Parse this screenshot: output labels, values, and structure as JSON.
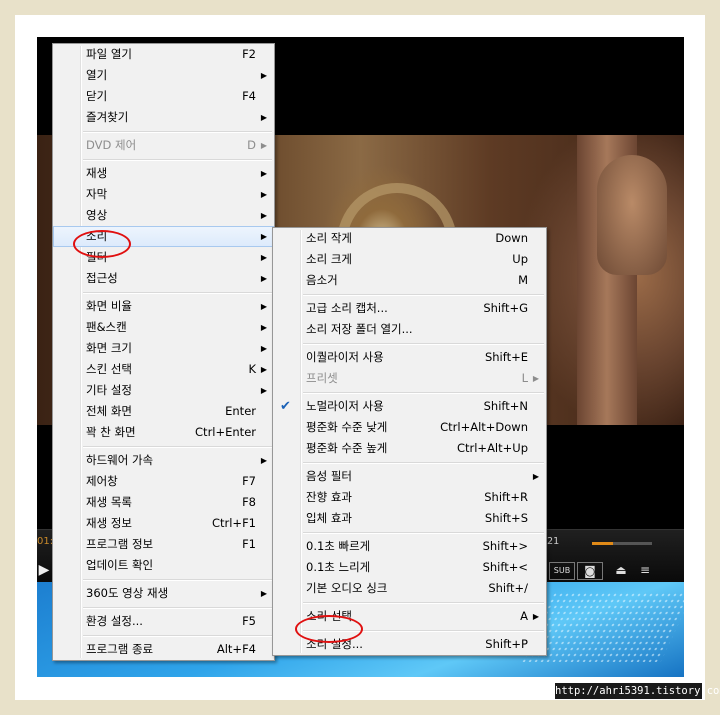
{
  "video": {
    "time_left": "01:",
    "time_right": "21",
    "seek_progress": 0.35,
    "sub_label": "SUB"
  },
  "watermark": "http://ahri5391.tistory.com",
  "main_menu": [
    {
      "label": "파일 열기",
      "shortcut": "F2"
    },
    {
      "label": "열기",
      "arrow": true
    },
    {
      "label": "닫기",
      "shortcut": "F4"
    },
    {
      "label": "즐겨찾기",
      "arrow": true
    },
    {
      "sep": true
    },
    {
      "label": "DVD 제어",
      "shortcut": "D",
      "arrow": true,
      "disabled": true
    },
    {
      "sep": true
    },
    {
      "label": "재생",
      "arrow": true
    },
    {
      "label": "자막",
      "arrow": true
    },
    {
      "label": "영상",
      "arrow": true
    },
    {
      "label": "소리",
      "arrow": true,
      "highlight": true
    },
    {
      "label": "필터",
      "arrow": true
    },
    {
      "label": "접근성",
      "arrow": true
    },
    {
      "sep": true
    },
    {
      "label": "화면 비율",
      "arrow": true
    },
    {
      "label": "팬&스캔",
      "arrow": true
    },
    {
      "label": "화면 크기",
      "arrow": true
    },
    {
      "label": "스킨 선택",
      "shortcut": "K",
      "arrow": true
    },
    {
      "label": "기타 설정",
      "arrow": true
    },
    {
      "label": "전체 화면",
      "shortcut": "Enter"
    },
    {
      "label": "꽉 찬 화면",
      "shortcut": "Ctrl+Enter"
    },
    {
      "sep": true
    },
    {
      "label": "하드웨어 가속",
      "arrow": true
    },
    {
      "label": "제어창",
      "shortcut": "F7"
    },
    {
      "label": "재생 목록",
      "shortcut": "F8"
    },
    {
      "label": "재생 정보",
      "shortcut": "Ctrl+F1"
    },
    {
      "label": "프로그램 정보",
      "shortcut": "F1"
    },
    {
      "label": "업데이트 확인"
    },
    {
      "sep": true
    },
    {
      "label": "360도 영상 재생",
      "arrow": true
    },
    {
      "sep": true
    },
    {
      "label": "환경 설정...",
      "shortcut": "F5"
    },
    {
      "sep": true
    },
    {
      "label": "프로그램 종료",
      "shortcut": "Alt+F4"
    }
  ],
  "sound_menu": [
    {
      "label": "소리 작게",
      "shortcut": "Down"
    },
    {
      "label": "소리 크게",
      "shortcut": "Up"
    },
    {
      "label": "음소거",
      "shortcut": "M"
    },
    {
      "sep": true
    },
    {
      "label": "고급 소리 캡처...",
      "shortcut": "Shift+G"
    },
    {
      "label": "소리 저장 폴더 열기..."
    },
    {
      "sep": true
    },
    {
      "label": "이퀄라이저 사용",
      "shortcut": "Shift+E"
    },
    {
      "label": "프리셋",
      "shortcut": "L",
      "arrow": true,
      "disabled": true
    },
    {
      "sep": true
    },
    {
      "label": "노멀라이저 사용",
      "shortcut": "Shift+N",
      "checked": true
    },
    {
      "label": "평준화 수준 낮게",
      "shortcut": "Ctrl+Alt+Down"
    },
    {
      "label": "평준화 수준 높게",
      "shortcut": "Ctrl+Alt+Up"
    },
    {
      "sep": true
    },
    {
      "label": "음성 필터",
      "arrow": true
    },
    {
      "label": "잔향 효과",
      "shortcut": "Shift+R"
    },
    {
      "label": "입체 효과",
      "shortcut": "Shift+S"
    },
    {
      "sep": true
    },
    {
      "label": "0.1초 빠르게",
      "shortcut": "Shift+>"
    },
    {
      "label": "0.1초 느리게",
      "shortcut": "Shift+<"
    },
    {
      "label": "기본 오디오 싱크",
      "shortcut": "Shift+/"
    },
    {
      "sep": true
    },
    {
      "label": "소리 선택",
      "shortcut": "A",
      "arrow": true
    },
    {
      "sep": true
    },
    {
      "label": "소리 설정...",
      "shortcut": "Shift+P"
    }
  ],
  "annotation_color": "#e01010",
  "highlight_color": "#dceafc"
}
